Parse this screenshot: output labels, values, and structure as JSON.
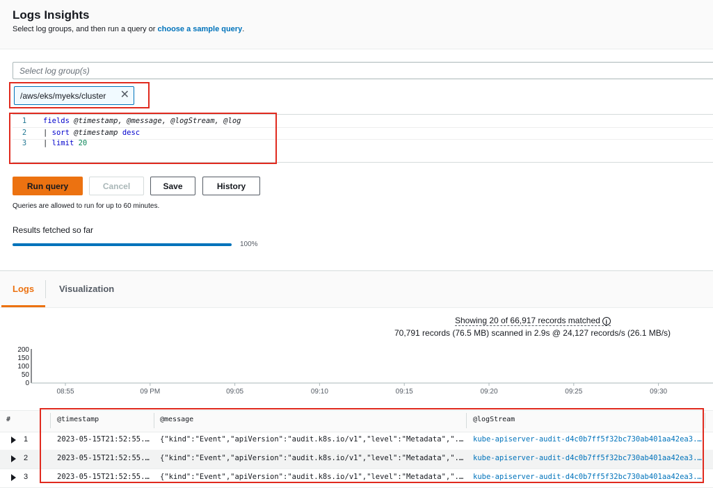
{
  "header": {
    "title": "Logs Insights",
    "subtitle_prefix": "Select log groups, and then run a query or ",
    "subtitle_link": "choose a sample query",
    "subtitle_suffix": "."
  },
  "log_group_select": {
    "placeholder": "Select log group(s)"
  },
  "selected_log_group": {
    "label": "/aws/eks/myeks/cluster"
  },
  "editor": {
    "lines": [
      {
        "number": "1",
        "text": "fields @timestamp, @message, @logStream, @log"
      },
      {
        "number": "2",
        "text": "| sort @timestamp desc"
      },
      {
        "number": "3",
        "text": "| limit 20"
      }
    ]
  },
  "actions": {
    "run_query": "Run query",
    "cancel": "Cancel",
    "save": "Save",
    "history": "History",
    "note": "Queries are allowed to run for up to 60 minutes."
  },
  "progress": {
    "label": "Results fetched so far",
    "value": 1.0,
    "text": "100%"
  },
  "tabs": [
    {
      "label": "Logs",
      "active": true
    },
    {
      "label": "Visualization",
      "active": false
    }
  ],
  "summary": {
    "showing": "Showing 20 of 66,917 records matched",
    "scanned": "70,791 records (76.5 MB) scanned in 2.9s @ 24,127 records/s (26.1 MB/s)"
  },
  "histogram": {
    "y_ticks": [
      "200",
      "150",
      "100",
      "50",
      "0"
    ],
    "x_ticks": [
      "08:55",
      "09 PM",
      "09:05",
      "09:10",
      "09:15",
      "09:20",
      "09:25",
      "09:30"
    ]
  },
  "table": {
    "columns": [
      "#",
      "@timestamp",
      "@message",
      "@logStream"
    ],
    "rows": [
      {
        "num": "1",
        "timestamp": "2023-05-15T21:52:55....",
        "message": "{\"kind\":\"Event\",\"apiVersion\":\"audit.k8s.io/v1\",\"level\":\"Metadata\",\"...",
        "logStream": "kube-apiserver-audit-d4c0b7ff5f32bc730ab401aa42ea3..."
      },
      {
        "num": "2",
        "timestamp": "2023-05-15T21:52:55....",
        "message": "{\"kind\":\"Event\",\"apiVersion\":\"audit.k8s.io/v1\",\"level\":\"Metadata\",\"...",
        "logStream": "kube-apiserver-audit-d4c0b7ff5f32bc730ab401aa42ea3..."
      },
      {
        "num": "3",
        "timestamp": "2023-05-15T21:52:55....",
        "message": "{\"kind\":\"Event\",\"apiVersion\":\"audit.k8s.io/v1\",\"level\":\"Metadata\",\"...",
        "logStream": "kube-apiserver-audit-d4c0b7ff5f32bc730ab401aa42ea3..."
      }
    ]
  },
  "colors": {
    "accent": "#ec7211",
    "link": "#0073bb",
    "highlight_box": "#e02a1e"
  }
}
